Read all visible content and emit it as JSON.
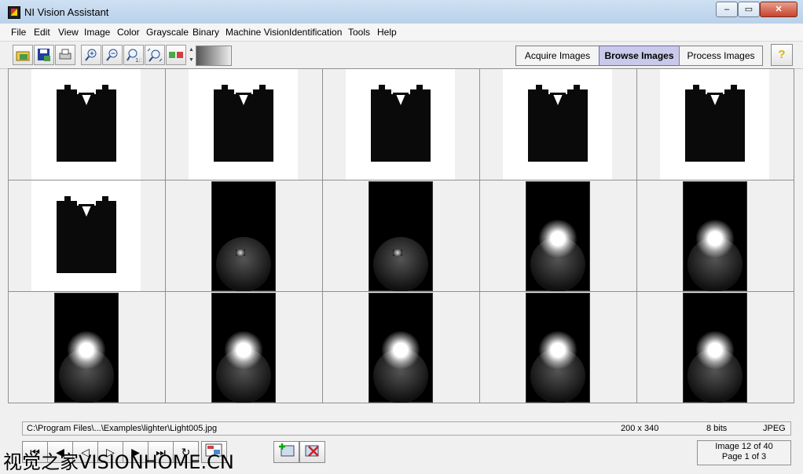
{
  "window": {
    "title": "NI Vision Assistant",
    "controls": [
      "–",
      "▭",
      "✕"
    ]
  },
  "menu": [
    "File",
    "Edit",
    "View",
    "Image",
    "Color",
    "Grayscale",
    "Binary",
    "Machine Vision",
    "Identification",
    "Tools",
    "Help"
  ],
  "toolbar": {
    "icons": [
      "open-image-icon",
      "save-image-icon",
      "print-icon",
      "zoom-in-icon",
      "zoom-out-icon",
      "zoom-1to1-icon",
      "zoom-fit-icon",
      "palette-icon",
      "gradient-swatch"
    ]
  },
  "modes": {
    "acquire": "Acquire Images",
    "browse": "Browse Images",
    "process": "Process Images",
    "help": "?"
  },
  "thumbnails": [
    "white-key",
    "white-key",
    "white-key",
    "white-key",
    "white-key",
    "white-key",
    "dark-lighter",
    "dark-lighter",
    "dark-spark",
    "dark-spark",
    "dark-spark",
    "dark-spark",
    "dark-spark",
    "dark-spark",
    "dark-spark"
  ],
  "status": {
    "path": "C:\\Program Files\\...\\Examples\\lighter\\Light005.jpg",
    "size": "200 x 340",
    "depth": "8 bits",
    "format": "JPEG"
  },
  "counter": {
    "image": "Image 12 of 40",
    "page": "Page 1 of 3"
  },
  "watermark": "视觉之家VISIONHOME.CN"
}
